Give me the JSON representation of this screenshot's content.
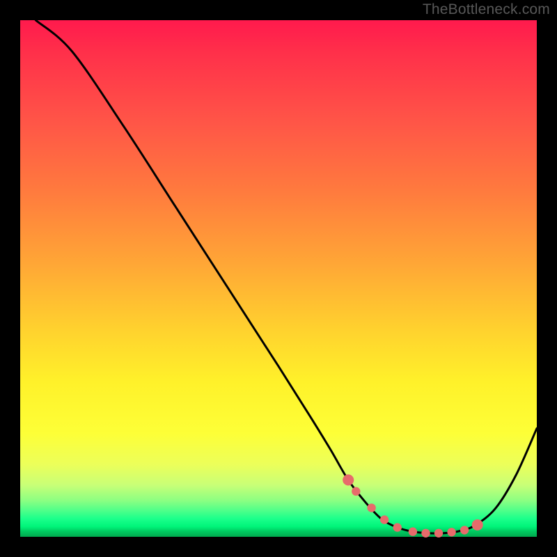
{
  "watermark": "TheBottleneck.com",
  "chart_data": {
    "type": "line",
    "title": "",
    "xlabel": "",
    "ylabel": "",
    "xlim": [
      0,
      100
    ],
    "ylim": [
      0,
      100
    ],
    "grid": false,
    "legend": false,
    "series": [
      {
        "name": "curve",
        "color": "#000000",
        "x": [
          3,
          10,
          20,
          30,
          40,
          50,
          56,
          60,
          63.5,
          67,
          70,
          73,
          76,
          79,
          82,
          85,
          88,
          92,
          96,
          100
        ],
        "y": [
          100,
          94,
          79.5,
          64,
          48.5,
          33,
          23.5,
          17,
          11,
          6.5,
          3.4,
          1.8,
          1.0,
          0.7,
          0.7,
          1.1,
          2.2,
          5.5,
          12,
          21
        ]
      }
    ],
    "markers": {
      "name": "highlight-dots",
      "color": "#e76b6b",
      "x": [
        63.5,
        65,
        68,
        70.5,
        73,
        76,
        78.5,
        81,
        83.5,
        86,
        88.5
      ],
      "y": [
        11,
        8.8,
        5.6,
        3.3,
        1.8,
        1.0,
        0.7,
        0.7,
        0.9,
        1.3,
        2.3
      ]
    },
    "gradient_stops": [
      {
        "pos": 0,
        "color": "#ff1a4d"
      },
      {
        "pos": 20,
        "color": "#ff5647"
      },
      {
        "pos": 47,
        "color": "#ffa636"
      },
      {
        "pos": 70,
        "color": "#fff12a"
      },
      {
        "pos": 90,
        "color": "#c8ff77"
      },
      {
        "pos": 96,
        "color": "#1bff8b"
      },
      {
        "pos": 100,
        "color": "#00a94e"
      }
    ]
  }
}
